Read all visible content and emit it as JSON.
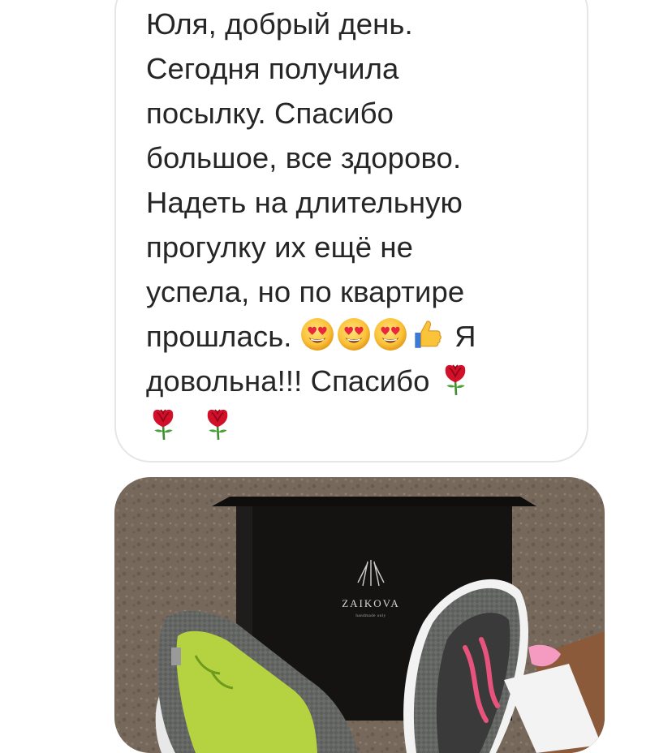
{
  "message": {
    "lines": [
      "Юля, добрый день.",
      "Сегодня получила",
      "посылку. Спасибо",
      "большое, все здорово.",
      "Надеть на длительную",
      "прогулку их ещё не",
      "успела, но по квартире",
      "прошлась.",
      "Я",
      "довольна!!! Спасибо"
    ],
    "emojis": {
      "line8": [
        "heart-eyes-emoji",
        "heart-eyes-emoji",
        "heart-eyes-emoji",
        "thumbs-up-emoji"
      ],
      "line9": [
        "rose-emoji"
      ],
      "line10": [
        "rose-emoji",
        "rose-emoji"
      ]
    }
  },
  "photo": {
    "brand_name": "ZAIKOVA",
    "brand_tagline": "handmade only"
  },
  "colors": {
    "text": "#262626",
    "bubble_border": "#e6e6e6",
    "wall": "#7f6f62",
    "box": "#141312",
    "shoe_knit": "#6b6d6b",
    "insole": "#b5d341",
    "accent_pink": "#e8537d"
  }
}
